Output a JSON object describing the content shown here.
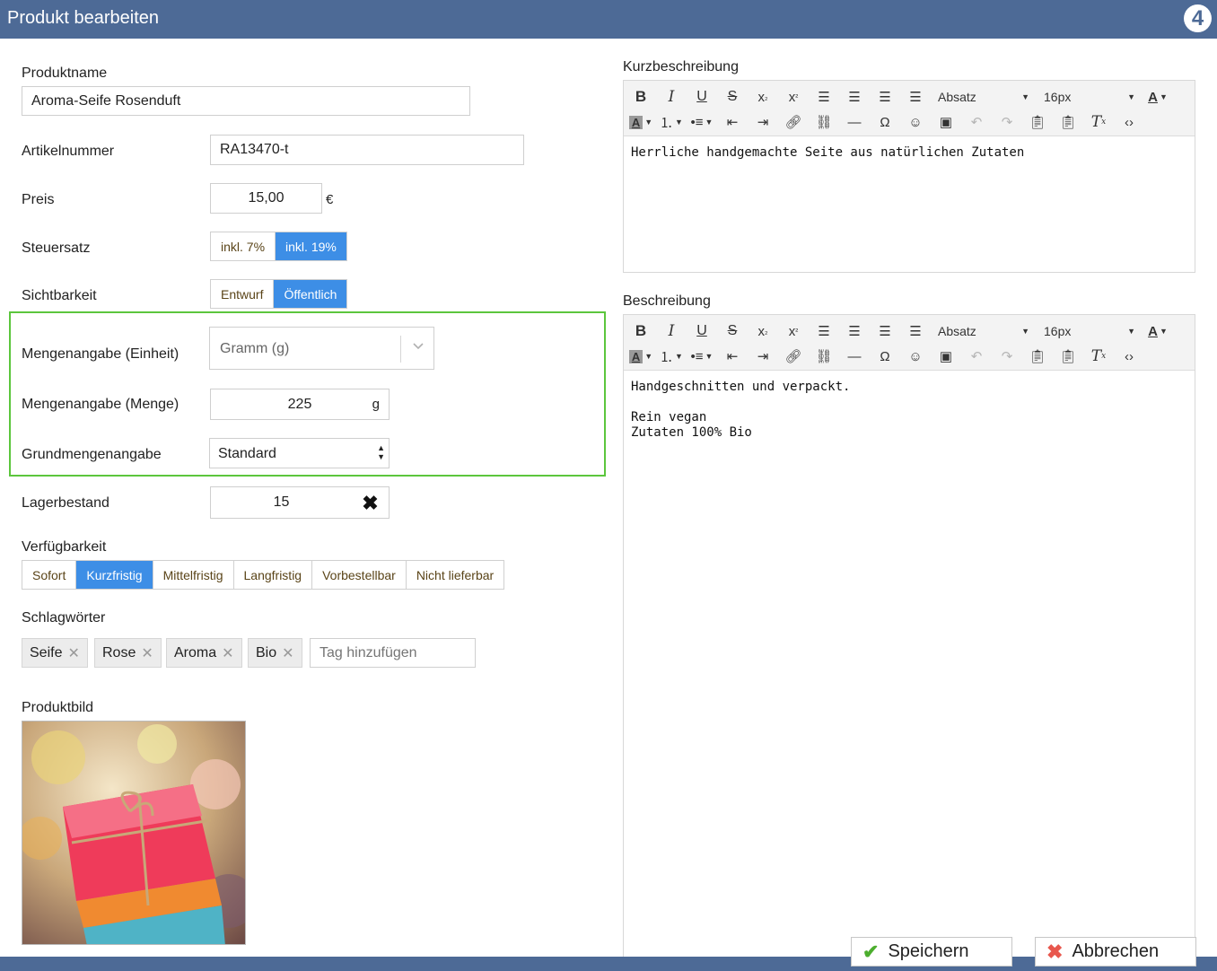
{
  "header": {
    "title": "Produkt bearbeiten",
    "logo": "4"
  },
  "form": {
    "produktname": {
      "label": "Produktname",
      "value": "Aroma-Seife Rosenduft"
    },
    "artikelnummer": {
      "label": "Artikelnummer",
      "value": "RA13470-t"
    },
    "preis": {
      "label": "Preis",
      "value": "15,00",
      "currency": "€"
    },
    "steuersatz": {
      "label": "Steuersatz",
      "options": [
        "inkl. 7%",
        "inkl. 19%"
      ],
      "selected": "inkl. 19%"
    },
    "sichtbarkeit": {
      "label": "Sichtbarkeit",
      "options": [
        "Entwurf",
        "Öffentlich"
      ],
      "selected": "Öffentlich"
    },
    "mengenangabe_einheit": {
      "label": "Mengenangabe (Einheit)",
      "value": "Gramm (g)"
    },
    "mengenangabe_menge": {
      "label": "Mengenangabe (Menge)",
      "value": "225",
      "unit": "g"
    },
    "grundmengenangabe": {
      "label": "Grundmengenangabe",
      "value": "Standard"
    },
    "lagerbestand": {
      "label": "Lagerbestand",
      "value": "15"
    },
    "verfuegbarkeit": {
      "label": "Verfügbarkeit",
      "options": [
        "Sofort",
        "Kurzfristig",
        "Mittelfristig",
        "Langfristig",
        "Vorbestellbar",
        "Nicht lieferbar"
      ],
      "selected": "Kurzfristig"
    },
    "schlagwoerter": {
      "label": "Schlagwörter",
      "tags": [
        "Seife",
        "Rose",
        "Aroma",
        "Bio"
      ],
      "placeholder": "Tag hinzufügen"
    },
    "produktbild": {
      "label": "Produktbild"
    }
  },
  "editors": {
    "toolbar": {
      "format": "Absatz",
      "size": "16px"
    },
    "kurz": {
      "label": "Kurzbeschreibung",
      "lines": [
        "Herrliche handgemachte Seite aus natürlichen Zutaten"
      ]
    },
    "lang": {
      "label": "Beschreibung",
      "lines": [
        "Handgeschnitten und verpackt.",
        "",
        "Rein vegan",
        "Zutaten 100% Bio"
      ]
    }
  },
  "actions": {
    "save": "Speichern",
    "cancel": "Abbrechen"
  },
  "colors": {
    "header": "#4d6a96",
    "accent": "#3d8ee6",
    "highlight_box": "#5cc63d",
    "save_icon": "#4cae2e",
    "cancel_icon": "#e8574d"
  }
}
